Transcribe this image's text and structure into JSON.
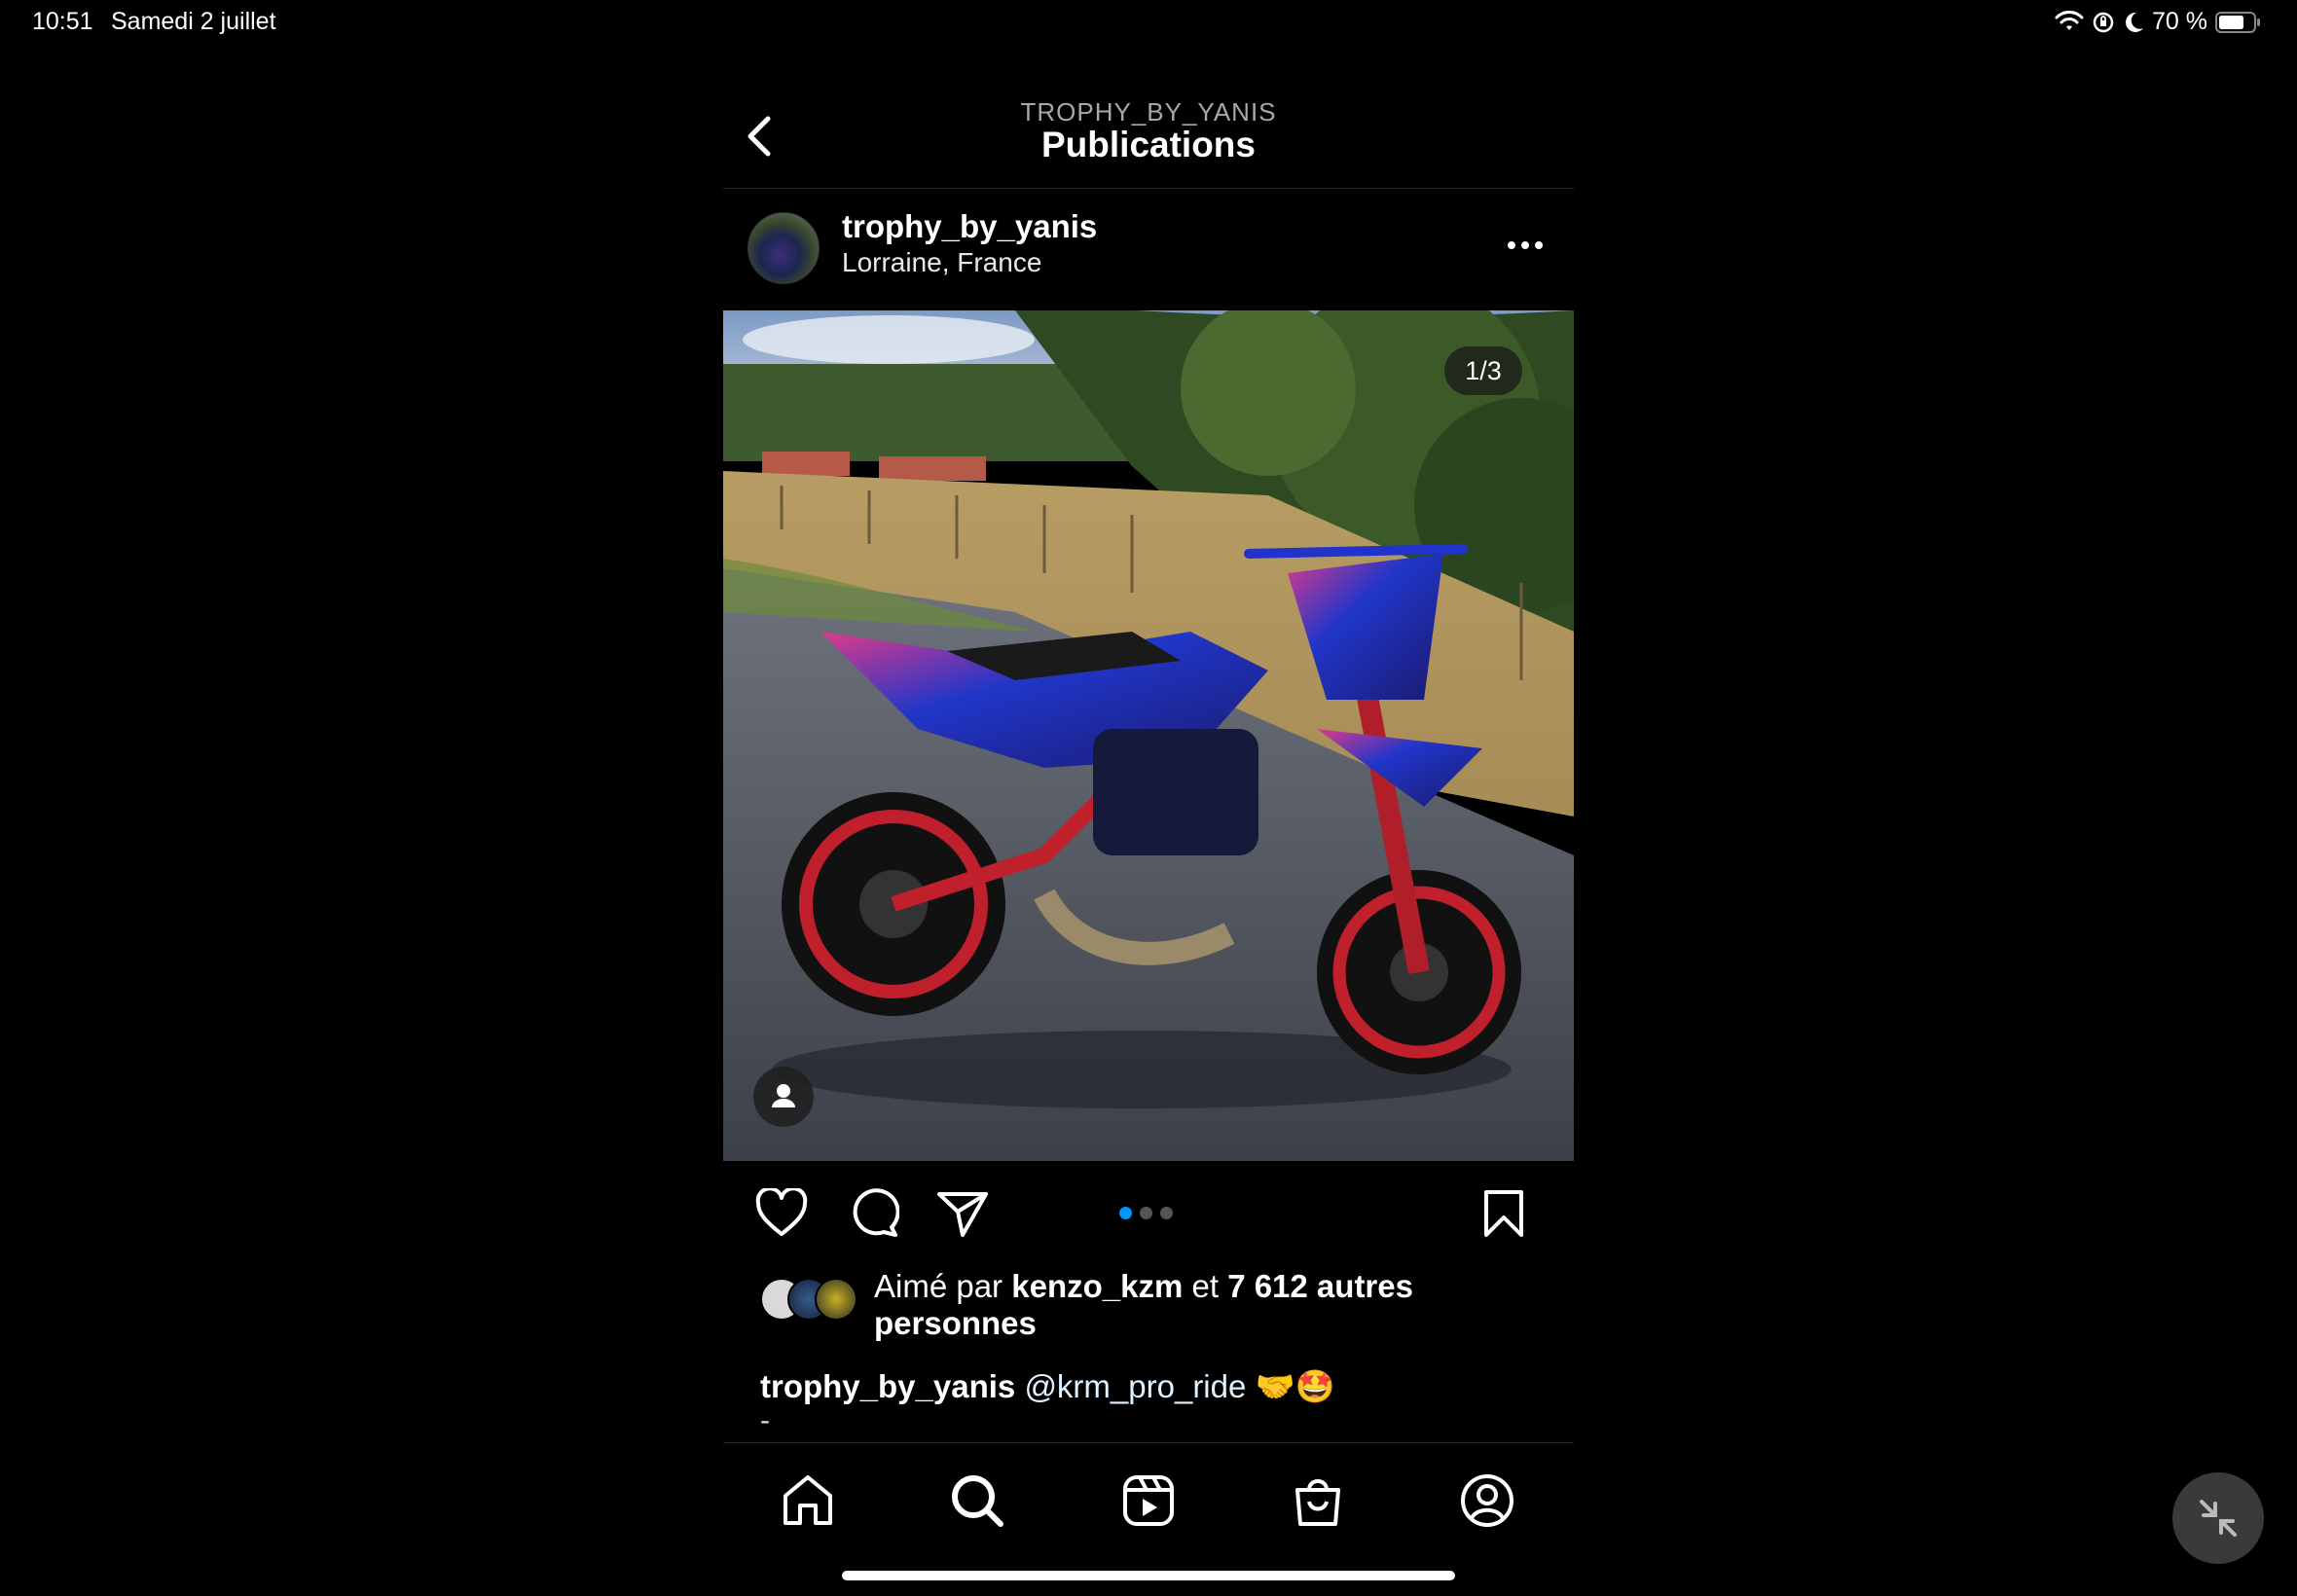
{
  "status_bar": {
    "time": "10:51",
    "date": "Samedi 2 juillet",
    "battery": "70 %",
    "icons": [
      "wifi-icon",
      "orientation-lock-icon",
      "moon-icon",
      "battery-icon"
    ]
  },
  "header": {
    "subtitle": "TROPHY_BY_YANIS",
    "title": "Publications",
    "back_icon": "chevron-left-icon"
  },
  "post": {
    "username": "trophy_by_yanis",
    "location": "Lorraine, France",
    "more_icon": "more-horizontal-icon",
    "image_counter": "1/3",
    "carousel": {
      "total": 3,
      "active_index": 0
    },
    "likes": {
      "prefix": "Aimé par",
      "liker": "kenzo_kzm",
      "conjunction": "et",
      "others": "7 612 autres personnes"
    },
    "caption": {
      "username": "trophy_by_yanis",
      "mention": "@krm_pro_ride",
      "emojis": "🤝🤩",
      "next_line": "-"
    }
  },
  "actions": [
    "heart-icon",
    "comment-icon",
    "share-icon",
    "bookmark-icon"
  ],
  "tabbar": [
    "home-icon",
    "search-icon",
    "reels-icon",
    "shop-icon",
    "profile-icon"
  ],
  "colors": {
    "accent": "#0095f6",
    "background": "#000000"
  }
}
